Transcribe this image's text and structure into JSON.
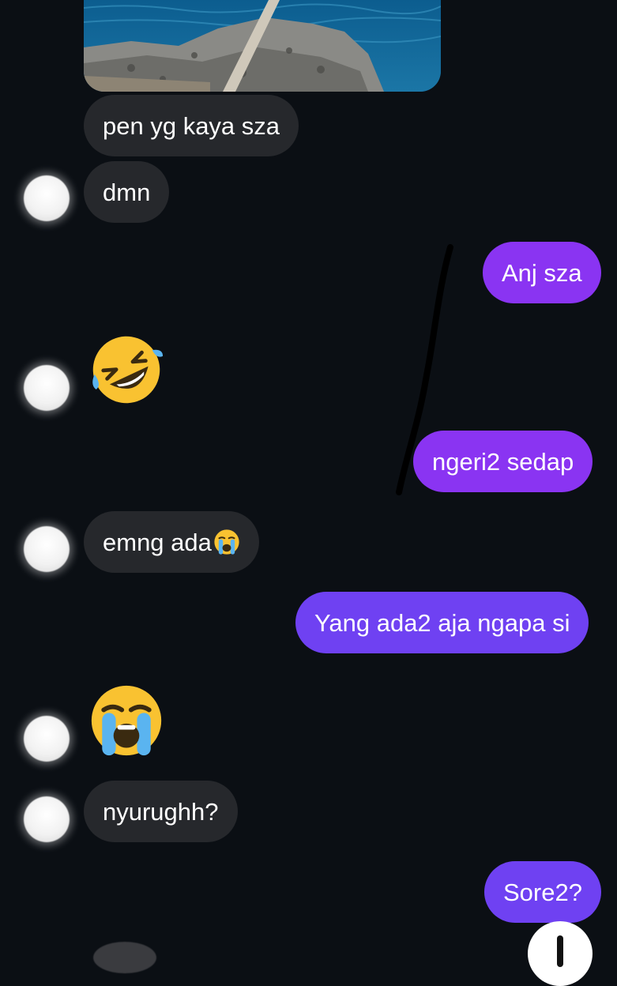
{
  "messages": {
    "m1": "pen yg kaya sza",
    "m2": "dmn",
    "m3": "Anj sza",
    "m4": "ngeri2 sedap",
    "m5": "emng ada",
    "m6": "Yang ada2 aja ngapa si",
    "m7": "nyurughh?",
    "m8": "Sore2?"
  },
  "emojis": {
    "e1": "rolling-on-floor-laughing",
    "e2": "loudly-crying-face",
    "e3": "loudly-crying-face"
  },
  "colors": {
    "background": "#0b0f14",
    "incoming_bubble": "#26282c",
    "outgoing_bubble_purple": "#8a34f2",
    "outgoing_bubble_blue": "#6f41f2"
  },
  "icons": {
    "scroll": "scroll-to-bottom-icon"
  }
}
